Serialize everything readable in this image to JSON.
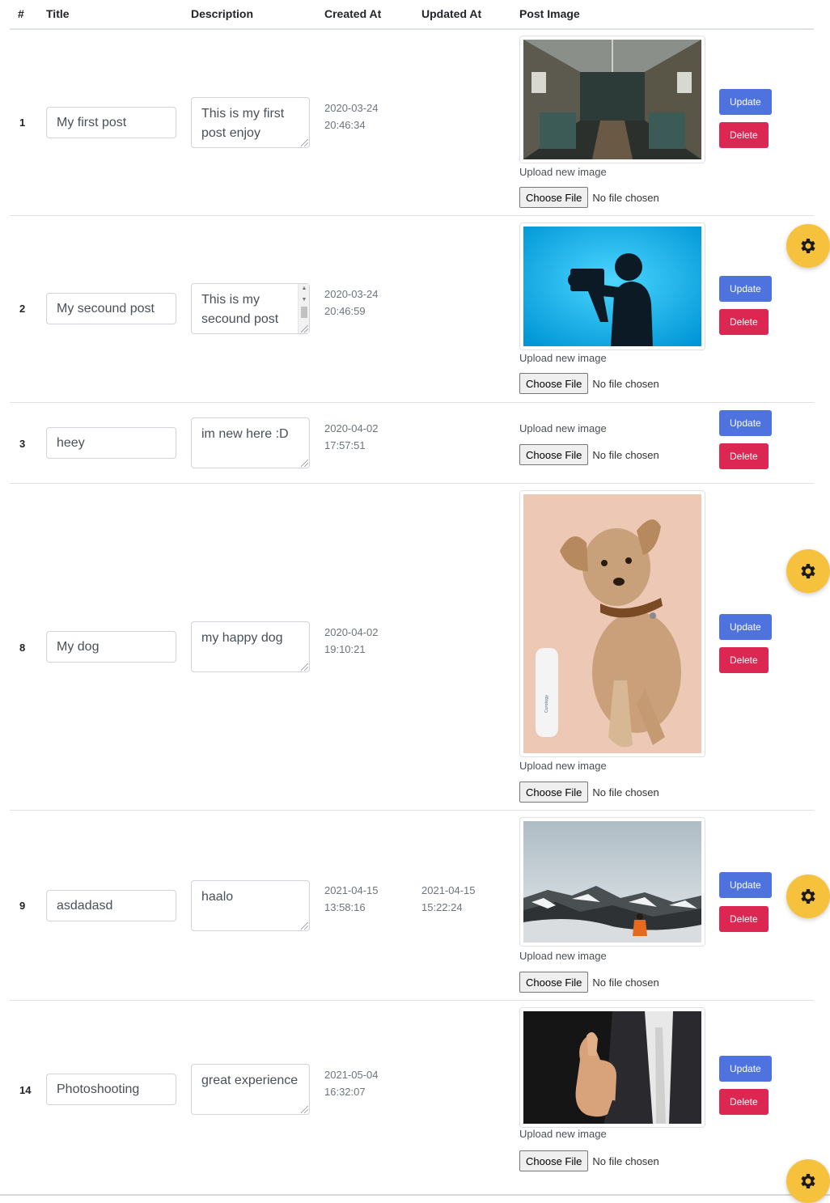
{
  "table": {
    "headers": {
      "id": "#",
      "title": "Title",
      "description": "Description",
      "created": "Created At",
      "updated": "Updated At",
      "image": "Post Image"
    }
  },
  "posts": [
    {
      "id": "1",
      "title": "My first post",
      "description": "This is my first post enjoy",
      "created_date": "2020-03-24",
      "created_time": "20:46:34",
      "updated_date": "",
      "updated_time": "",
      "has_image": true,
      "image_desc": "train-interior"
    },
    {
      "id": "2",
      "title": "My secound post",
      "description": "This is my secound post",
      "created_date": "2020-03-24",
      "created_time": "20:46:59",
      "updated_date": "",
      "updated_time": "",
      "has_image": true,
      "image_desc": "photographer-silhouette"
    },
    {
      "id": "3",
      "title": "heey",
      "description": "im new here :D",
      "created_date": "2020-04-02",
      "created_time": "17:57:51",
      "updated_date": "",
      "updated_time": "",
      "has_image": false
    },
    {
      "id": "8",
      "title": "My dog",
      "description": "my happy dog",
      "created_date": "2020-04-02",
      "created_time": "19:10:21",
      "updated_date": "",
      "updated_time": "",
      "has_image": true,
      "image_desc": "puppy"
    },
    {
      "id": "9",
      "title": "asdadasd",
      "description": "haalo",
      "created_date": "2021-04-15",
      "created_time": "13:58:16",
      "updated_date": "2021-04-15",
      "updated_time": "15:22:24",
      "has_image": true,
      "image_desc": "snowy-mountain-hiker"
    },
    {
      "id": "14",
      "title": "Photoshooting",
      "description": "great experience",
      "created_date": "2021-05-04",
      "created_time": "16:32:07",
      "updated_date": "",
      "updated_time": "",
      "has_image": true,
      "image_desc": "thumbs-up-businessman"
    }
  ],
  "labels": {
    "upload_new_image": "Upload new image",
    "choose_file": "Choose File",
    "no_file_chosen": "No file chosen",
    "update": "Update",
    "delete": "Delete"
  },
  "icons": {
    "settings": "gear-icon"
  },
  "colors": {
    "update": "#4e73df",
    "delete": "#dc2753",
    "settings_fab": "#f6c23e"
  }
}
